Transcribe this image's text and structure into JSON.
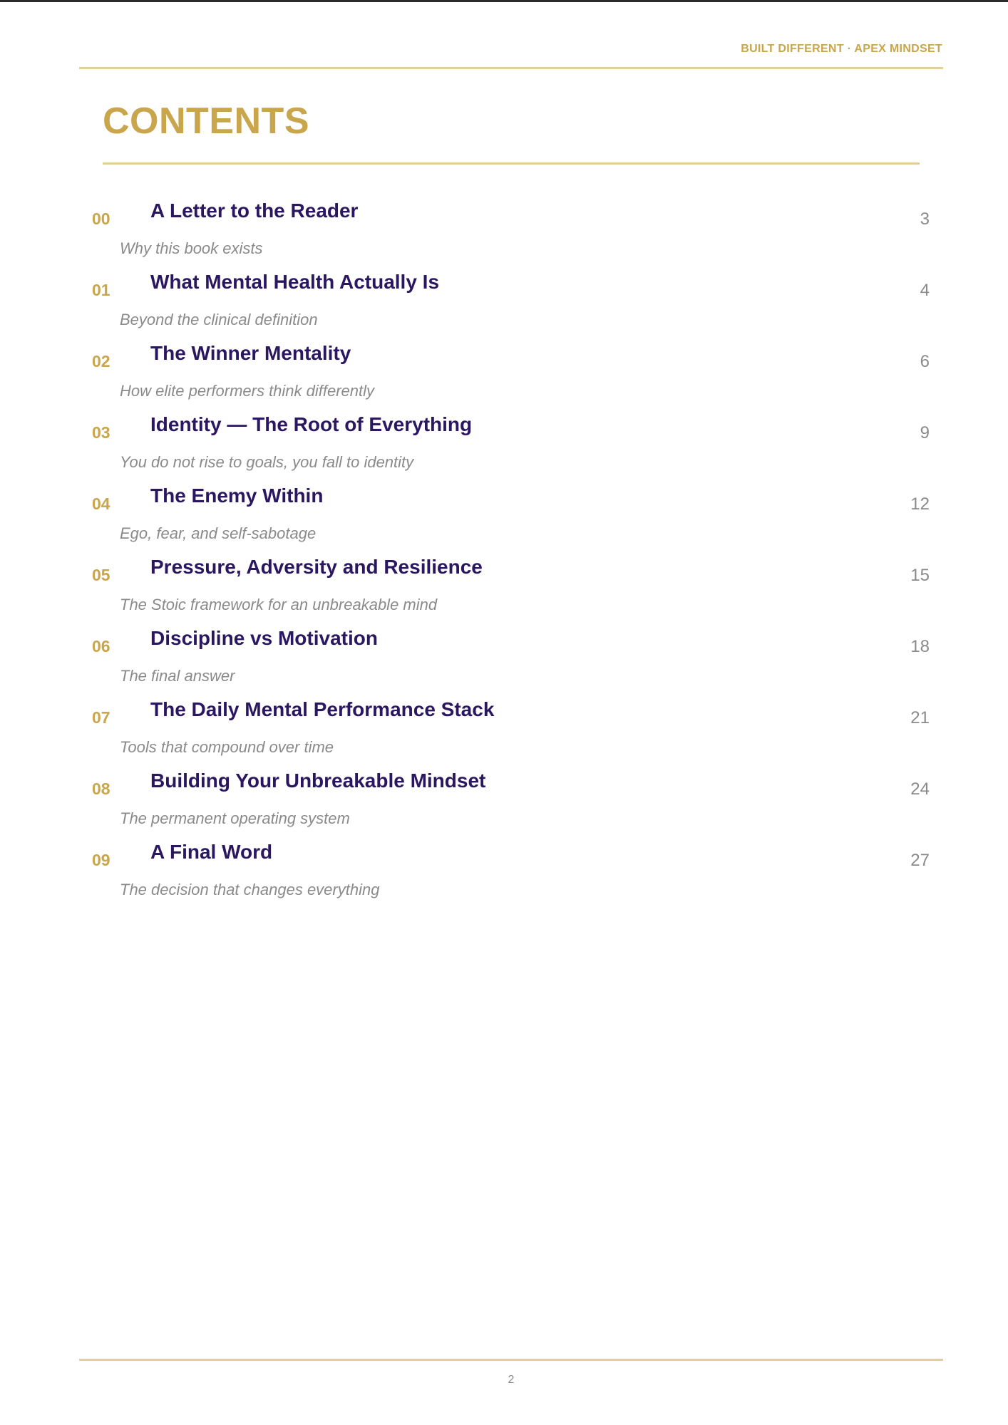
{
  "header": {
    "running_title": "BUILT DIFFERENT · APEX MINDSET"
  },
  "contents": {
    "title": "CONTENTS",
    "entries": [
      {
        "number": "00",
        "title": "A Letter to the Reader",
        "subtitle": "Why this book exists",
        "page": "3"
      },
      {
        "number": "01",
        "title": "What Mental Health Actually Is",
        "subtitle": "Beyond the clinical definition",
        "page": "4"
      },
      {
        "number": "02",
        "title": "The Winner Mentality",
        "subtitle": "How elite performers think differently",
        "page": "6"
      },
      {
        "number": "03",
        "title": "Identity — The Root of Everything",
        "subtitle": "You do not rise to goals, you fall to identity",
        "page": "9"
      },
      {
        "number": "04",
        "title": "The Enemy Within",
        "subtitle": "Ego, fear, and self-sabotage",
        "page": "12"
      },
      {
        "number": "05",
        "title": "Pressure, Adversity and Resilience",
        "subtitle": "The Stoic framework for an unbreakable mind",
        "page": "15"
      },
      {
        "number": "06",
        "title": "Discipline vs Motivation",
        "subtitle": "The final answer",
        "page": "18"
      },
      {
        "number": "07",
        "title": "The Daily Mental Performance Stack",
        "subtitle": "Tools that compound over time",
        "page": "21"
      },
      {
        "number": "08",
        "title": "Building Your Unbreakable Mindset",
        "subtitle": "The permanent operating system",
        "page": "24"
      },
      {
        "number": "09",
        "title": "A Final Word",
        "subtitle": "The decision that changes everything",
        "page": "27"
      }
    ]
  },
  "footer": {
    "page_number": "2"
  },
  "colors": {
    "accent_gold": "#c9a54b",
    "rule_gold": "#e4cf97",
    "title_navy": "#2a1760",
    "muted_gray": "#8a8a8a"
  }
}
